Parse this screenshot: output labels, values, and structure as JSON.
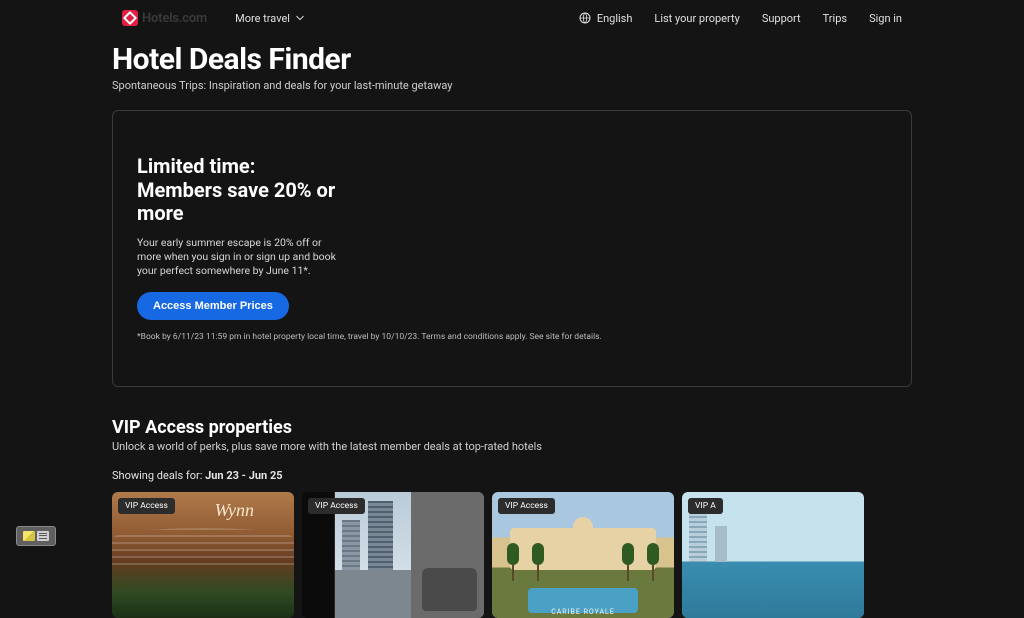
{
  "header": {
    "brand": "Hotels.com",
    "more_travel_label": "More travel",
    "language_label": "English",
    "nav": {
      "list_property": "List your property",
      "support": "Support",
      "trips": "Trips",
      "sign_in": "Sign in"
    }
  },
  "page": {
    "title": "Hotel Deals Finder",
    "subtitle": "Spontaneous Trips: Inspiration and deals for your last-minute getaway"
  },
  "promo": {
    "heading": "Limited time: Members save 20% or more",
    "description": "Your early summer escape is 20% off or more when you sign in or sign up and book your perfect somewhere by June 11*.",
    "cta_label": "Access Member Prices",
    "fineprint": "*Book by 6/11/23 11:59 pm in hotel property local time, travel by 10/10/23. Terms and conditions apply. See site for details."
  },
  "vip": {
    "title": "VIP Access properties",
    "subtitle": "Unlock a world of perks, plus save more with the latest member deals at top-rated hotels",
    "showing_prefix": "Showing deals for: ",
    "showing_dates": "Jun 23 - Jun 25",
    "badge_label": "VIP Access",
    "card3_caption": "CARIBE ROYALE",
    "cards": [
      {
        "badge": "VIP Access"
      },
      {
        "badge": "VIP Access"
      },
      {
        "badge": "VIP Access"
      },
      {
        "badge": "VIP A"
      }
    ]
  }
}
